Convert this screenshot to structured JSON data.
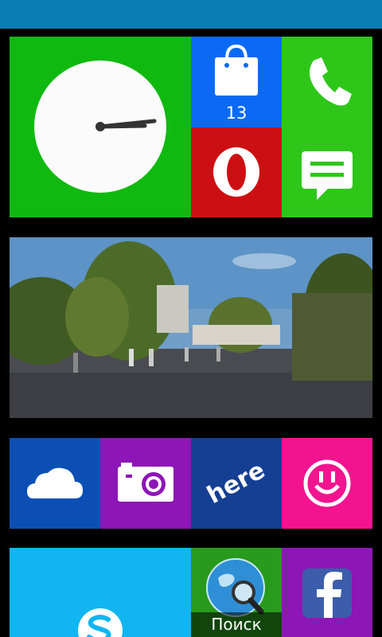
{
  "start_screen": {
    "store_tile": {
      "badge_count": "13",
      "icon": "shopping-bag-icon"
    },
    "search_tile": {
      "label": "Поиск",
      "icon": "globe-magnifier-icon"
    },
    "clock_tile": {
      "icon": "analog-clock"
    },
    "tiles": [
      {
        "name": "clock-tile",
        "color": "#10b910"
      },
      {
        "name": "store-tile",
        "color": "#0a6af5"
      },
      {
        "name": "phone-tile",
        "color": "#2fc61a"
      },
      {
        "name": "opera-tile",
        "color": "#cc0f12"
      },
      {
        "name": "messaging-tile",
        "color": "#2fc61a"
      },
      {
        "name": "onedrive-tile",
        "color": "#0b4fb4"
      },
      {
        "name": "camera-tile",
        "color": "#8d16b6"
      },
      {
        "name": "here-maps-tile",
        "color": "#143f93"
      },
      {
        "name": "mixradio-tile",
        "color": "#f4138f"
      },
      {
        "name": "skype-tile",
        "color": "#10b5f1"
      },
      {
        "name": "search-tile",
        "color": "#289a1c"
      },
      {
        "name": "facebook-tile",
        "color": "#8d16b6"
      }
    ]
  }
}
